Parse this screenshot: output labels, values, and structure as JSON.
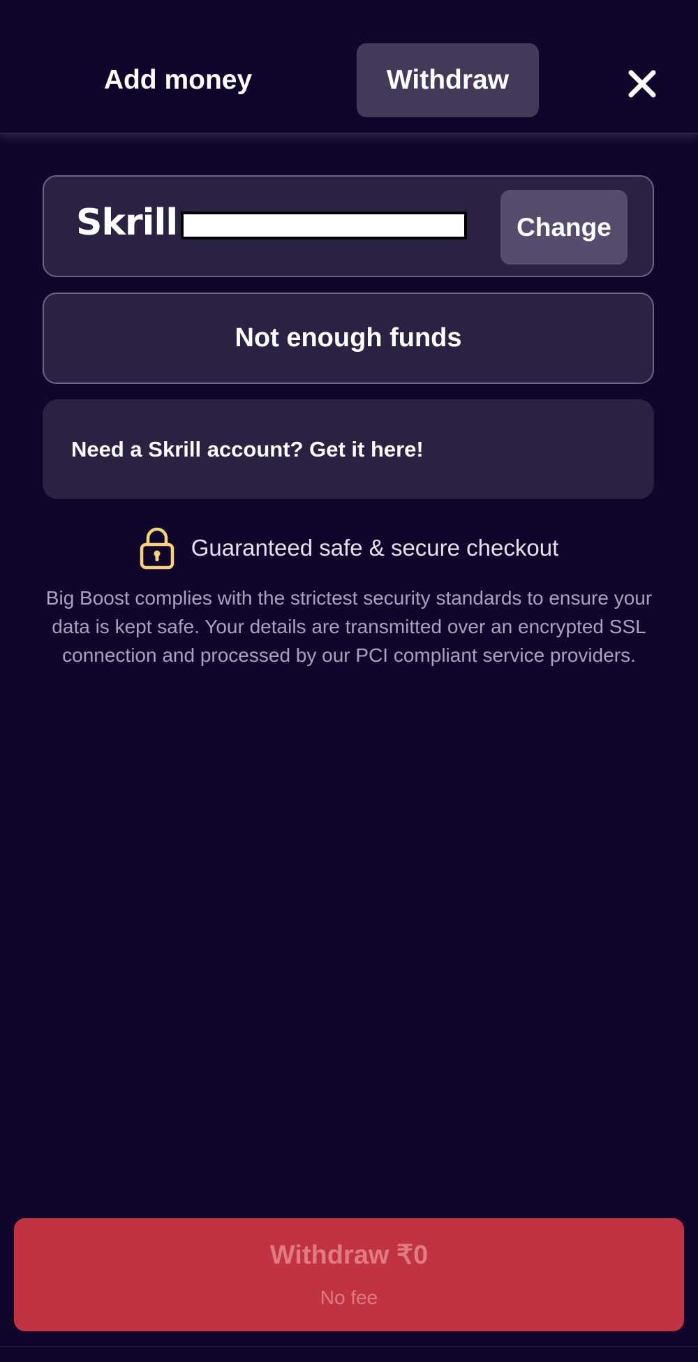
{
  "tabs": {
    "add_money": "Add money",
    "withdraw": "Withdraw"
  },
  "payment_method": {
    "logo": "Skrill",
    "change_label": "Change"
  },
  "funds_status": "Not enough funds",
  "promo_link": "Need a Skrill account? Get it here!",
  "security": {
    "icon": "lock-icon",
    "heading": "Guaranteed safe & secure checkout",
    "description": "Big Boost complies with the strictest security standards to ensure your data is kept safe. Your details are transmitted over an encrypted SSL connection and processed by our PCI compliant service providers."
  },
  "withdraw_button": {
    "label": "Withdraw ₹0",
    "fee": "No fee"
  },
  "colors": {
    "background": "#10062b",
    "card": "#2b2143",
    "active_tab": "#433a5a",
    "change_button": "#554c6e",
    "withdraw_button": "#c13242",
    "lock_accent": "#f7d27a"
  }
}
